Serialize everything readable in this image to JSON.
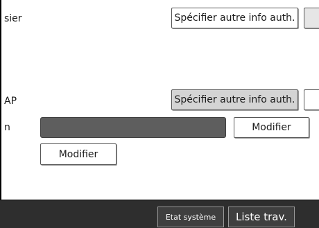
{
  "rows": {
    "row1_label": "sier",
    "row1_button": "Spécifier autre info auth.",
    "row2_label": "AP",
    "row2_button": "Spécifier autre info auth.",
    "row3_label": "n",
    "row3_button": "Modifier",
    "row4_button": "Modifier"
  },
  "footer": {
    "system_status": "Etat système",
    "job_list": "Liste trav."
  }
}
